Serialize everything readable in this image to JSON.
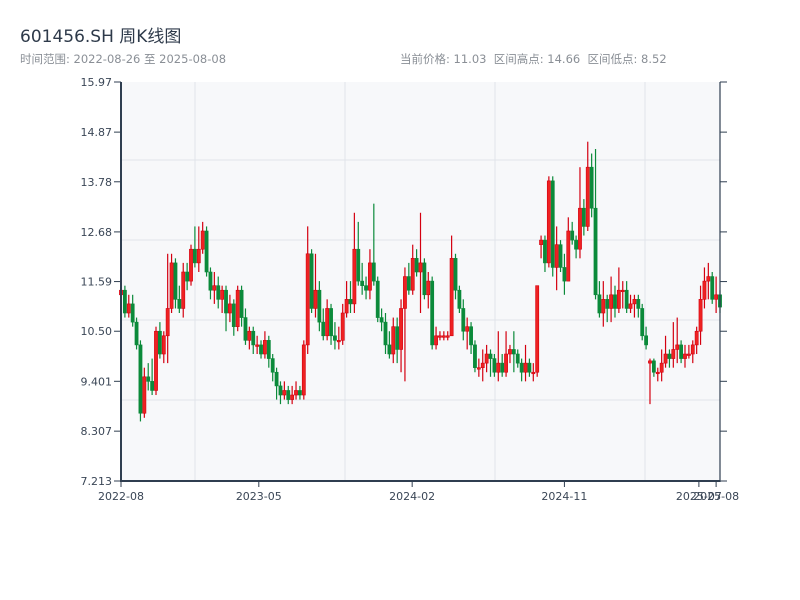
{
  "header": {
    "title": "601456.SH 周K线图",
    "range_text": "时间范围: 2022-08-26 至 2025-08-08",
    "stats_text": "当前价格: 11.03  区间高点: 14.66  区间低点: 8.52"
  },
  "chart_data": {
    "type": "candlestick",
    "title": "601456.SH 周K线图",
    "interval": "weekly",
    "date_range": [
      "2022-08-26",
      "2025-08-08"
    ],
    "current_price": 11.03,
    "range_high": 14.66,
    "range_low": 8.52,
    "ylim": [
      7.213,
      15.97
    ],
    "y_ticks": [
      "7.213",
      "8.307",
      "9.401",
      "10.50",
      "11.59",
      "12.68",
      "13.78",
      "14.87",
      "15.97"
    ],
    "x_ticks": [
      "2022-08",
      "2023-05",
      "2024-02",
      "2024-11",
      "2025-07",
      "2025-08"
    ],
    "grid": true,
    "colors": {
      "up": "#d40010",
      "down": "#0b8a3a",
      "background": "#f7f8fa",
      "axis": "#2f3e50",
      "grid": "#e1e4ea"
    },
    "ohlc_fields": [
      "open",
      "close",
      "low",
      "high"
    ],
    "ohlc": [
      [
        11.3,
        11.4,
        11.2,
        11.5
      ],
      [
        11.4,
        10.9,
        10.8,
        11.5
      ],
      [
        10.9,
        11.1,
        10.8,
        11.3
      ],
      [
        11.1,
        10.7,
        10.6,
        11.3
      ],
      [
        10.7,
        10.2,
        10.1,
        10.8
      ],
      [
        10.2,
        8.7,
        8.52,
        10.3
      ],
      [
        8.7,
        9.5,
        8.6,
        9.7
      ],
      [
        9.5,
        9.4,
        9.2,
        9.8
      ],
      [
        9.4,
        9.2,
        9.1,
        9.9
      ],
      [
        9.2,
        10.5,
        9.1,
        10.6
      ],
      [
        10.5,
        10.0,
        9.9,
        10.7
      ],
      [
        10.0,
        10.4,
        9.8,
        10.5
      ],
      [
        10.4,
        11.0,
        9.8,
        12.2
      ],
      [
        11.0,
        12.0,
        10.9,
        12.2
      ],
      [
        12.0,
        11.2,
        11.0,
        12.1
      ],
      [
        11.2,
        11.0,
        10.9,
        11.5
      ],
      [
        11.0,
        11.8,
        10.8,
        12.0
      ],
      [
        11.8,
        11.6,
        11.4,
        12.0
      ],
      [
        11.6,
        12.3,
        11.5,
        12.4
      ],
      [
        12.3,
        12.0,
        11.9,
        12.8
      ],
      [
        12.0,
        12.3,
        11.8,
        12.8
      ],
      [
        12.3,
        12.7,
        12.2,
        12.9
      ],
      [
        12.7,
        11.8,
        11.7,
        12.8
      ],
      [
        11.8,
        11.4,
        11.2,
        11.9
      ],
      [
        11.4,
        11.5,
        11.1,
        11.8
      ],
      [
        11.5,
        11.2,
        11.0,
        11.7
      ],
      [
        11.2,
        11.4,
        10.9,
        11.5
      ],
      [
        11.4,
        10.9,
        10.5,
        11.5
      ],
      [
        10.9,
        11.1,
        10.7,
        11.3
      ],
      [
        11.1,
        10.6,
        10.4,
        11.2
      ],
      [
        10.6,
        11.4,
        10.5,
        11.5
      ],
      [
        11.4,
        10.8,
        10.6,
        11.5
      ],
      [
        10.8,
        10.3,
        10.2,
        11.0
      ],
      [
        10.3,
        10.5,
        10.1,
        10.6
      ],
      [
        10.5,
        10.2,
        10.0,
        10.6
      ],
      [
        10.2,
        10.2,
        10.0,
        10.4
      ],
      [
        10.2,
        10.0,
        9.9,
        10.3
      ],
      [
        10.0,
        10.3,
        9.9,
        10.5
      ],
      [
        10.3,
        9.9,
        9.7,
        10.4
      ],
      [
        9.9,
        9.6,
        9.4,
        10.0
      ],
      [
        9.6,
        9.3,
        9.0,
        9.7
      ],
      [
        9.3,
        9.1,
        8.9,
        9.4
      ],
      [
        9.1,
        9.2,
        9.0,
        9.4
      ],
      [
        9.2,
        9.0,
        8.9,
        9.3
      ],
      [
        9.0,
        9.1,
        8.9,
        9.3
      ],
      [
        9.1,
        9.2,
        9.0,
        9.4
      ],
      [
        9.2,
        9.1,
        9.0,
        9.3
      ],
      [
        9.1,
        10.2,
        9.0,
        10.3
      ],
      [
        10.2,
        12.2,
        10.0,
        12.8
      ],
      [
        12.2,
        11.0,
        10.9,
        12.3
      ],
      [
        11.0,
        11.4,
        10.8,
        12.2
      ],
      [
        11.4,
        10.7,
        10.5,
        11.6
      ],
      [
        10.7,
        10.4,
        10.3,
        11.0
      ],
      [
        10.4,
        11.0,
        10.3,
        11.2
      ],
      [
        11.0,
        10.4,
        10.2,
        11.1
      ],
      [
        10.4,
        10.3,
        10.1,
        10.7
      ],
      [
        10.3,
        10.3,
        10.1,
        10.6
      ],
      [
        10.3,
        10.9,
        10.2,
        11.1
      ],
      [
        10.9,
        11.2,
        10.8,
        11.6
      ],
      [
        11.2,
        11.1,
        10.9,
        11.6
      ],
      [
        11.1,
        12.3,
        10.9,
        13.1
      ],
      [
        12.3,
        11.6,
        11.5,
        12.9
      ],
      [
        11.6,
        11.5,
        11.3,
        12.0
      ],
      [
        11.5,
        11.4,
        11.2,
        11.7
      ],
      [
        11.4,
        12.0,
        11.2,
        12.3
      ],
      [
        12.0,
        11.6,
        11.5,
        13.3
      ],
      [
        11.6,
        10.8,
        10.7,
        11.7
      ],
      [
        10.8,
        10.7,
        10.5,
        11.0
      ],
      [
        10.7,
        10.2,
        10.0,
        10.9
      ],
      [
        10.2,
        10.0,
        9.9,
        10.5
      ],
      [
        10.0,
        10.6,
        9.8,
        10.8
      ],
      [
        10.6,
        10.1,
        9.8,
        10.8
      ],
      [
        10.1,
        11.0,
        9.6,
        11.2
      ],
      [
        11.0,
        11.7,
        9.4,
        11.9
      ],
      [
        11.7,
        11.4,
        11.3,
        12.0
      ],
      [
        11.4,
        12.1,
        11.3,
        12.4
      ],
      [
        12.1,
        11.8,
        11.7,
        12.3
      ],
      [
        11.8,
        12.0,
        10.9,
        13.1
      ],
      [
        12.0,
        11.3,
        11.2,
        12.1
      ],
      [
        11.3,
        11.6,
        11.0,
        11.8
      ],
      [
        11.6,
        10.2,
        10.1,
        11.7
      ],
      [
        10.2,
        10.4,
        10.1,
        10.6
      ],
      [
        10.4,
        10.4,
        10.3,
        10.5
      ],
      [
        10.4,
        10.4,
        10.3,
        10.5
      ],
      [
        10.4,
        10.4,
        10.3,
        10.5
      ],
      [
        10.4,
        12.1,
        10.4,
        12.6
      ],
      [
        12.1,
        11.4,
        11.2,
        12.2
      ],
      [
        11.4,
        11.0,
        10.9,
        11.5
      ],
      [
        11.0,
        10.5,
        10.3,
        11.2
      ],
      [
        10.5,
        10.6,
        10.1,
        10.8
      ],
      [
        10.6,
        10.2,
        10.0,
        10.7
      ],
      [
        10.2,
        9.7,
        9.6,
        10.3
      ],
      [
        9.7,
        9.7,
        9.5,
        9.9
      ],
      [
        9.7,
        9.8,
        9.4,
        10.1
      ],
      [
        9.8,
        10.0,
        9.6,
        10.2
      ],
      [
        10.0,
        9.9,
        9.5,
        10.1
      ],
      [
        9.9,
        9.6,
        9.5,
        10.0
      ],
      [
        9.6,
        9.8,
        9.4,
        10.5
      ],
      [
        9.8,
        9.6,
        9.5,
        10.0
      ],
      [
        9.6,
        10.0,
        9.5,
        10.5
      ],
      [
        10.0,
        10.1,
        9.8,
        10.2
      ],
      [
        10.1,
        10.0,
        9.6,
        10.5
      ],
      [
        10.0,
        9.8,
        9.7,
        10.1
      ],
      [
        9.8,
        9.6,
        9.4,
        9.9
      ],
      [
        9.6,
        9.8,
        9.4,
        10.2
      ],
      [
        9.8,
        9.6,
        9.5,
        9.9
      ],
      [
        9.6,
        9.6,
        9.4,
        9.8
      ],
      [
        9.6,
        11.5,
        9.5,
        11.5
      ],
      [
        12.4,
        12.5,
        12.1,
        12.6
      ],
      [
        12.5,
        12.0,
        11.8,
        12.6
      ],
      [
        12.0,
        13.8,
        11.9,
        13.9
      ],
      [
        13.8,
        11.9,
        11.7,
        13.9
      ],
      [
        11.9,
        12.4,
        11.4,
        12.8
      ],
      [
        12.4,
        11.9,
        11.8,
        12.5
      ],
      [
        11.9,
        11.6,
        11.3,
        12.2
      ],
      [
        11.6,
        12.7,
        11.6,
        13.0
      ],
      [
        12.7,
        12.5,
        12.4,
        12.9
      ],
      [
        12.5,
        12.3,
        12.1,
        12.6
      ],
      [
        12.3,
        13.2,
        12.1,
        14.1
      ],
      [
        13.2,
        12.8,
        12.6,
        13.4
      ],
      [
        12.8,
        14.1,
        12.7,
        14.66
      ],
      [
        14.1,
        13.2,
        13.0,
        14.4
      ],
      [
        13.2,
        11.3,
        11.2,
        14.5
      ],
      [
        11.3,
        10.9,
        10.8,
        11.6
      ],
      [
        10.9,
        11.2,
        10.6,
        11.6
      ],
      [
        11.2,
        11.0,
        10.7,
        11.3
      ],
      [
        11.0,
        11.3,
        10.7,
        11.7
      ],
      [
        11.3,
        11.0,
        10.8,
        11.5
      ],
      [
        11.0,
        11.4,
        10.9,
        11.9
      ],
      [
        11.4,
        11.4,
        11.0,
        11.6
      ],
      [
        11.4,
        11.0,
        10.9,
        11.6
      ],
      [
        11.0,
        11.1,
        10.9,
        11.3
      ],
      [
        11.1,
        11.2,
        10.8,
        11.3
      ],
      [
        11.2,
        11.0,
        10.8,
        11.3
      ],
      [
        11.0,
        10.4,
        10.3,
        11.1
      ],
      [
        10.4,
        10.2,
        10.1,
        10.6
      ],
      [
        9.8,
        9.85,
        8.9,
        9.9
      ],
      [
        9.85,
        9.6,
        9.5,
        9.9
      ],
      [
        9.6,
        9.6,
        9.4,
        9.7
      ],
      [
        9.6,
        9.8,
        9.4,
        10.1
      ],
      [
        9.8,
        10.0,
        9.7,
        10.4
      ],
      [
        10.0,
        9.9,
        9.7,
        10.1
      ],
      [
        9.9,
        10.1,
        9.7,
        10.7
      ],
      [
        10.1,
        10.2,
        9.8,
        10.8
      ],
      [
        10.2,
        9.9,
        9.8,
        10.3
      ],
      [
        9.9,
        10.0,
        9.7,
        10.2
      ],
      [
        10.0,
        10.0,
        9.9,
        10.2
      ],
      [
        10.0,
        10.2,
        9.8,
        10.3
      ],
      [
        10.2,
        10.5,
        10.0,
        10.6
      ],
      [
        10.5,
        11.2,
        10.2,
        11.5
      ],
      [
        11.2,
        11.6,
        11.0,
        11.9
      ],
      [
        11.6,
        11.7,
        11.2,
        12.0
      ],
      [
        11.7,
        11.2,
        11.1,
        11.8
      ],
      [
        11.2,
        11.3,
        10.9,
        11.7
      ],
      [
        11.3,
        11.03,
        10.9,
        11.4
      ]
    ]
  }
}
